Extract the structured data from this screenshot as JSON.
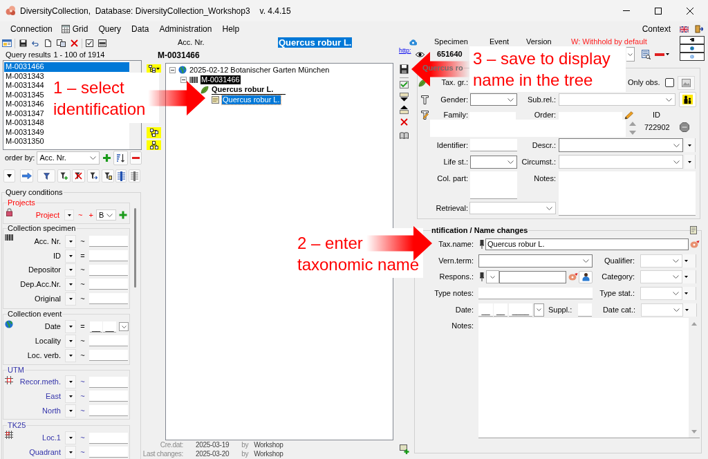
{
  "window": {
    "title": "DiversityCollection,  Database: DiversityCollection_Workshop3",
    "version": "v. 4.4.15"
  },
  "menu": [
    {
      "label": "Connection",
      "kind": "text"
    },
    {
      "label": "Grid",
      "kind": "grid"
    },
    {
      "label": "Query",
      "kind": "text"
    },
    {
      "label": "Data",
      "kind": "text"
    },
    {
      "label": "Administration",
      "kind": "text"
    },
    {
      "label": "Help",
      "kind": "text"
    }
  ],
  "context_menu": "Context",
  "query_results": {
    "label": "Query results",
    "range": "1 - 100 of 1914",
    "items": [
      {
        "text": "M-0031466",
        "selected": true
      },
      {
        "text": "M-0031343",
        "selected": false
      },
      {
        "text": "M-0031344",
        "selected": false
      },
      {
        "text": "M-0031345",
        "selected": false
      },
      {
        "text": "M-0031346",
        "selected": false
      },
      {
        "text": "M-0031347",
        "selected": false
      },
      {
        "text": "M-0031348",
        "selected": false
      },
      {
        "text": "M-0031349",
        "selected": false
      },
      {
        "text": "M-0031350",
        "selected": false
      }
    ]
  },
  "order_by": {
    "label": "order by:",
    "value": "Acc. Nr."
  },
  "query_conditions": {
    "title": "Query conditions",
    "groups": [
      {
        "title": "Projects",
        "kind": "project",
        "rows": [
          {
            "label": "Project",
            "operator": "~",
            "kind": "project",
            "plus": "+",
            "value": "B"
          }
        ]
      },
      {
        "title": "Collection specimen",
        "kind": "specimen",
        "rows": [
          {
            "label": "Acc. Nr.",
            "operator": "~",
            "kind": "text"
          },
          {
            "label": "ID",
            "operator": "=",
            "kind": "text"
          },
          {
            "label": "Depositor",
            "operator": "~",
            "kind": "text"
          },
          {
            "label": "Dep.Acc.Nr.",
            "operator": "~",
            "kind": "text"
          },
          {
            "label": "Original",
            "operator": "~",
            "kind": "text"
          }
        ]
      },
      {
        "title": "Collection event",
        "kind": "event",
        "rows": [
          {
            "label": "Date",
            "operator": "=",
            "kind": "date",
            "parts": [
              "__",
              "__"
            ]
          },
          {
            "label": "Locality",
            "operator": "~",
            "kind": "text"
          },
          {
            "label": "Loc. verb.",
            "operator": "~",
            "kind": "text"
          }
        ]
      },
      {
        "title": "UTM",
        "kind": "utm",
        "rows": [
          {
            "label": "Recor.meth.",
            "operator": "~",
            "kind": "text"
          },
          {
            "label": "East",
            "operator": "~",
            "kind": "text"
          },
          {
            "label": "North",
            "operator": "~",
            "kind": "text"
          }
        ]
      },
      {
        "title": "TK25",
        "kind": "tk25",
        "rows": [
          {
            "label": "Loc.1",
            "operator": "~",
            "kind": "text"
          },
          {
            "label": "Quadrant",
            "operator": "~",
            "kind": "text"
          }
        ]
      }
    ]
  },
  "record": {
    "acc_label": "Acc. Nr.",
    "acc_number": "M-0031466",
    "taxon": "Quercus robur L."
  },
  "tree": [
    {
      "text": "2025-02-12 Botanischer Garten München",
      "kind": "event",
      "expanded": true,
      "selected": false,
      "children": [
        {
          "text": "M-0031466",
          "kind": "specimen",
          "expanded": true,
          "selected": false,
          "children": [
            {
              "text": "Quercus robur L.",
              "kind": "unit",
              "selected": false,
              "children": [
                {
                  "text": "Quercus robur L.",
                  "kind": "identification",
                  "selected": true
                }
              ]
            }
          ]
        }
      ]
    }
  ],
  "record_info": [
    {
      "label": "Cre.dat:",
      "date": "2025-03-19",
      "by": "by",
      "user": "Workshop"
    },
    {
      "label": "Last changes:",
      "date": "2025-03-20",
      "by": "by",
      "user": "Workshop"
    }
  ],
  "specimen": {
    "link": "http:",
    "columns": [
      "Specimen",
      "Event",
      "Version"
    ],
    "withhold": "W: Withhold by default",
    "number": "651640"
  },
  "unit": {
    "title": "Quercus ro",
    "tax_group": "Tax. gr.:",
    "only_observed": {
      "label": "Only obs.",
      "checked": false
    },
    "gender": "Gender:",
    "sub_relation": "Sub.rel.:",
    "family": "Family:",
    "order": "Order:",
    "id": {
      "label": "ID",
      "value": "722902"
    },
    "identifier": "Identifier:",
    "description": "Descr.:",
    "life_stage": "Life st.:",
    "circumstances": "Circumst.:",
    "collected_part": "Col. part:",
    "notes": "Notes:",
    "retrieval": "Retrieval:"
  },
  "identification": {
    "title": "ntification / Name changes",
    "taxon_name": {
      "label": "Tax.name:",
      "value": "Quercus robur L."
    },
    "vernacular_term": "Vern.term:",
    "qualifier": "Qualifier:",
    "responsible": "Respons.:",
    "category": "Category:",
    "type_notes": "Type notes:",
    "type_status": "Type stat.:",
    "date": {
      "label": "Date:",
      "parts": [
        "__",
        "__",
        "____"
      ]
    },
    "supplement": "Suppl.:",
    "date_category": "Date cat.:",
    "notes": "Notes:"
  },
  "callouts": [
    {
      "lines": [
        "1 – select",
        "identification"
      ]
    },
    {
      "lines": [
        "2 – enter",
        "taxonomic name"
      ]
    },
    {
      "lines": [
        "3 – save to display",
        "name in the tree"
      ]
    }
  ]
}
